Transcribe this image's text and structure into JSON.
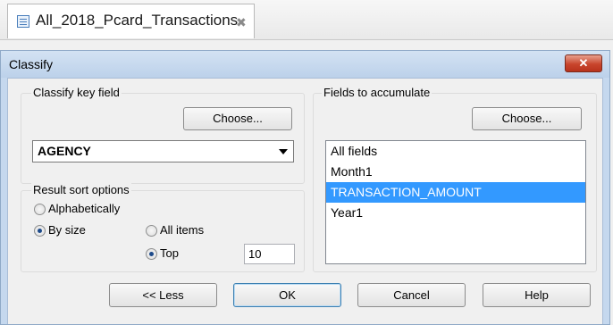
{
  "document_tab": {
    "title": "All_2018_Pcard_Transactions",
    "close_glyph": "✖"
  },
  "dialog": {
    "title": "Classify",
    "close_glyph": "✕",
    "classify_key_field": {
      "label": "Classify key field",
      "choose_label": "Choose...",
      "selected_value": "AGENCY"
    },
    "result_sort_options": {
      "label": "Result sort options",
      "alphabetically_label": "Alphabetically",
      "by_size_label": "By size",
      "all_items_label": "All items",
      "top_label": "Top",
      "top_value": "10",
      "sort_mode": "by_size",
      "item_mode": "top"
    },
    "fields_to_accumulate": {
      "label": "Fields to accumulate",
      "choose_label": "Choose...",
      "items": [
        "All fields",
        "Month1",
        "TRANSACTION_AMOUNT",
        "Year1"
      ],
      "selected_index": 2
    },
    "buttons": {
      "less_label": "<< Less",
      "ok_label": "OK",
      "cancel_label": "Cancel",
      "help_label": "Help"
    }
  },
  "colors": {
    "dialog_frame": "#c5d8ee",
    "selection": "#3399ff",
    "close_button": "#c8452c"
  }
}
